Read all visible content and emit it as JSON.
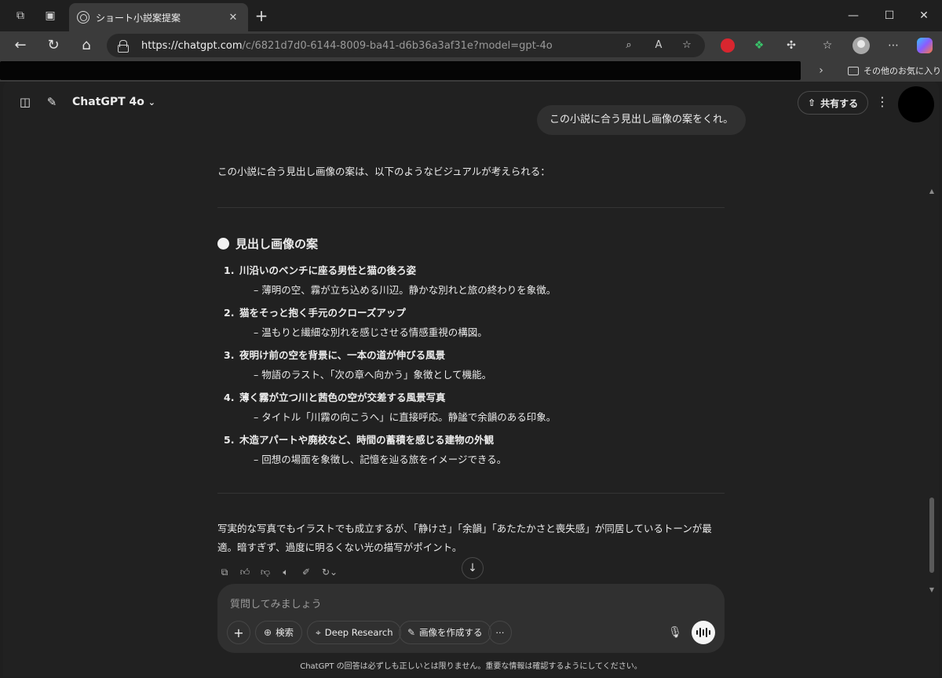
{
  "browser": {
    "tab_title": "ショート小説案提案",
    "url_host": "https://chatgpt.com",
    "url_path": "/c/6821d7d0-6144-8009-ba41-d6b36a3af31e?model=gpt-4o",
    "other_bookmarks_label": "その他のお気に入り"
  },
  "app": {
    "model_label": "ChatGPT 4o",
    "share_label": "共有する"
  },
  "conversation": {
    "user_message": "この小説に合う見出し画像の案をくれ。",
    "intro": "この小説に合う見出し画像の案は、以下のようなビジュアルが考えられる：",
    "section_title": "見出し画像の案",
    "items": [
      {
        "num": "1.",
        "title": "川沿いのベンチに座る男性と猫の後ろ姿",
        "desc": "– 薄明の空、霧が立ち込める川辺。静かな別れと旅の終わりを象徴。"
      },
      {
        "num": "2.",
        "title": "猫をそっと抱く手元のクローズアップ",
        "desc": "– 温もりと繊細な別れを感じさせる情感重視の構図。"
      },
      {
        "num": "3.",
        "title": "夜明け前の空を背景に、一本の道が伸びる風景",
        "desc": "– 物語のラスト、「次の章へ向かう」象徴として機能。"
      },
      {
        "num": "4.",
        "title": "薄く霧が立つ川と茜色の空が交差する風景写真",
        "desc": "– タイトル「川霧の向こうへ」に直接呼応。静謐で余韻のある印象。"
      },
      {
        "num": "5.",
        "title": "木造アパートや廃校など、時間の蓄積を感じる建物の外観",
        "desc": "– 回想の場面を象徴し、記憶を辿る旅をイメージできる。"
      }
    ],
    "outro": "写実的な写真でもイラストでも成立するが、「静けさ」「余韻」「あたたかさと喪失感」が同居しているトーンが最適。暗すぎず、過度に明るくない光の描写がポイント。"
  },
  "composer": {
    "placeholder": "質問してみましょう",
    "search_label": "検索",
    "deep_research_label": "Deep Research",
    "create_image_label": "画像を作成する"
  },
  "disclaimer": "ChatGPT の回答は必ずしも正しいとは限りません。重要な情報は確認するようにしてください。",
  "colors": {
    "background": "#212121",
    "bubble": "#303030",
    "text": "#ececec"
  }
}
